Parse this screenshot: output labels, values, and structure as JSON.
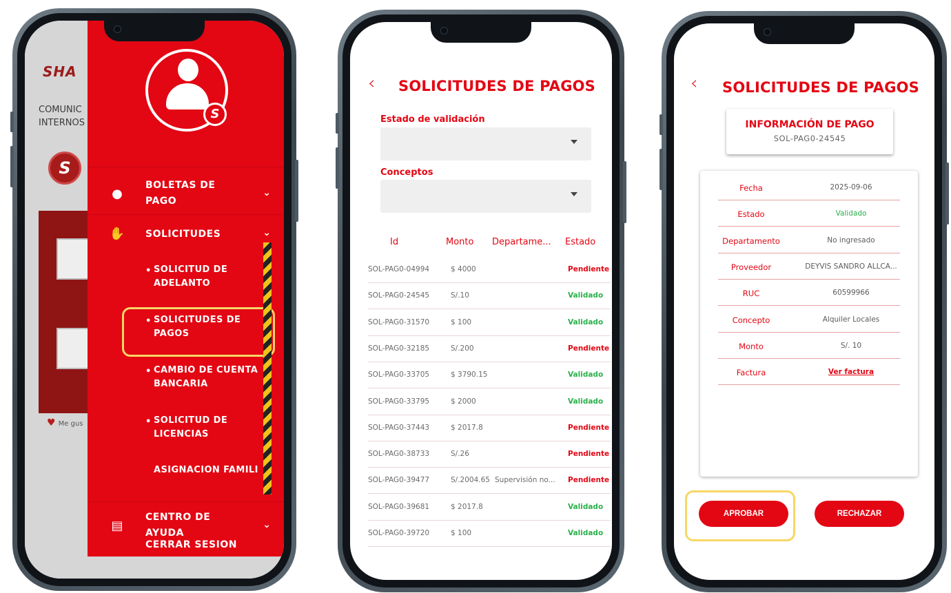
{
  "phone1": {
    "background": {
      "brand": "SHA",
      "text": "COMUNIC INTERNOS",
      "logo_letter": "S",
      "like_label": "Me gus"
    },
    "drawer": {
      "badge_letter": "S",
      "items": [
        {
          "id": "boletas",
          "label": "BOLETAS DE PAGO",
          "icon": "coins-icon"
        },
        {
          "id": "solicitudes",
          "label": "SOLICITUDES",
          "icon": "hand-money-icon"
        },
        {
          "id": "ayuda",
          "label": "CENTRO DE AYUDA",
          "icon": "document-search-icon"
        }
      ],
      "subitems": [
        {
          "label": "SOLICITUD DE ADELANTO"
        },
        {
          "label": "SOLICITUDES DE PAGOS"
        },
        {
          "label": "CAMBIO DE CUENTA BANCARIA"
        },
        {
          "label": "SOLICITUD DE LICENCIAS"
        },
        {
          "label": "ASIGNACION FAMILI"
        }
      ],
      "logout": "CERRAR SESION"
    }
  },
  "phone2": {
    "title": "SOLICITUDES DE PAGOS",
    "filters": {
      "estado_label": "Estado de validación",
      "conceptos_label": "Conceptos"
    },
    "columns": [
      "Id",
      "Monto",
      "Departame...",
      "Estado"
    ],
    "rows": [
      {
        "id": "SOL-PAG0-04994",
        "monto": "$ 4000",
        "depto": "",
        "estado": "Pendiente",
        "status": "pending"
      },
      {
        "id": "SOL-PAG0-24545",
        "monto": "S/.10",
        "depto": "",
        "estado": "Validado",
        "status": "valid"
      },
      {
        "id": "SOL-PAG0-31570",
        "monto": "$ 100",
        "depto": "",
        "estado": "Validado",
        "status": "valid"
      },
      {
        "id": "SOL-PAG0-32185",
        "monto": "S/.200",
        "depto": "",
        "estado": "Pendiente",
        "status": "pending"
      },
      {
        "id": "SOL-PAG0-33705",
        "monto": "$ 3790.15",
        "depto": "",
        "estado": "Validado",
        "status": "valid"
      },
      {
        "id": "SOL-PAG0-33795",
        "monto": "$ 2000",
        "depto": "",
        "estado": "Validado",
        "status": "valid"
      },
      {
        "id": "SOL-PAG0-37443",
        "monto": "$ 2017.8",
        "depto": "",
        "estado": "Pendiente",
        "status": "pending"
      },
      {
        "id": "SOL-PAG0-38733",
        "monto": "S/.26",
        "depto": "",
        "estado": "Pendiente",
        "status": "pending"
      },
      {
        "id": "SOL-PAG0-39477",
        "monto": "S/.2004.65",
        "depto": "Supervisión no...",
        "estado": "Pendiente",
        "status": "pending"
      },
      {
        "id": "SOL-PAG0-39681",
        "monto": "$ 2017.8",
        "depto": "",
        "estado": "Validado",
        "status": "valid"
      },
      {
        "id": "SOL-PAG0-39720",
        "monto": "$ 100",
        "depto": "",
        "estado": "Validado",
        "status": "valid"
      }
    ]
  },
  "phone3": {
    "title": "SOLICITUDES DE PAGOS",
    "card_title": "INFORMACIÓN DE PAGO",
    "card_id": "SOL-PAG0-24545",
    "details": [
      {
        "key": "Fecha",
        "value": "2025-09-06",
        "style": "plain"
      },
      {
        "key": "Estado",
        "value": "Validado",
        "style": "green"
      },
      {
        "key": "Departamento",
        "value": "No ingresado",
        "style": "plain"
      },
      {
        "key": "Proveedor",
        "value": "DEYVIS SANDRO ALLCA...",
        "style": "plain"
      },
      {
        "key": "RUC",
        "value": "60599966",
        "style": "plain"
      },
      {
        "key": "Concepto",
        "value": "Alquiler Locales",
        "style": "plain"
      },
      {
        "key": "Monto",
        "value": "S/. 10",
        "style": "plain"
      },
      {
        "key": "Factura",
        "value": "Ver factura",
        "style": "link"
      }
    ],
    "approve_label": "APROBAR",
    "reject_label": "RECHAZAR"
  },
  "colors": {
    "accent": "#e30613",
    "validated": "#2ab14a",
    "highlight": "#f7d766"
  }
}
